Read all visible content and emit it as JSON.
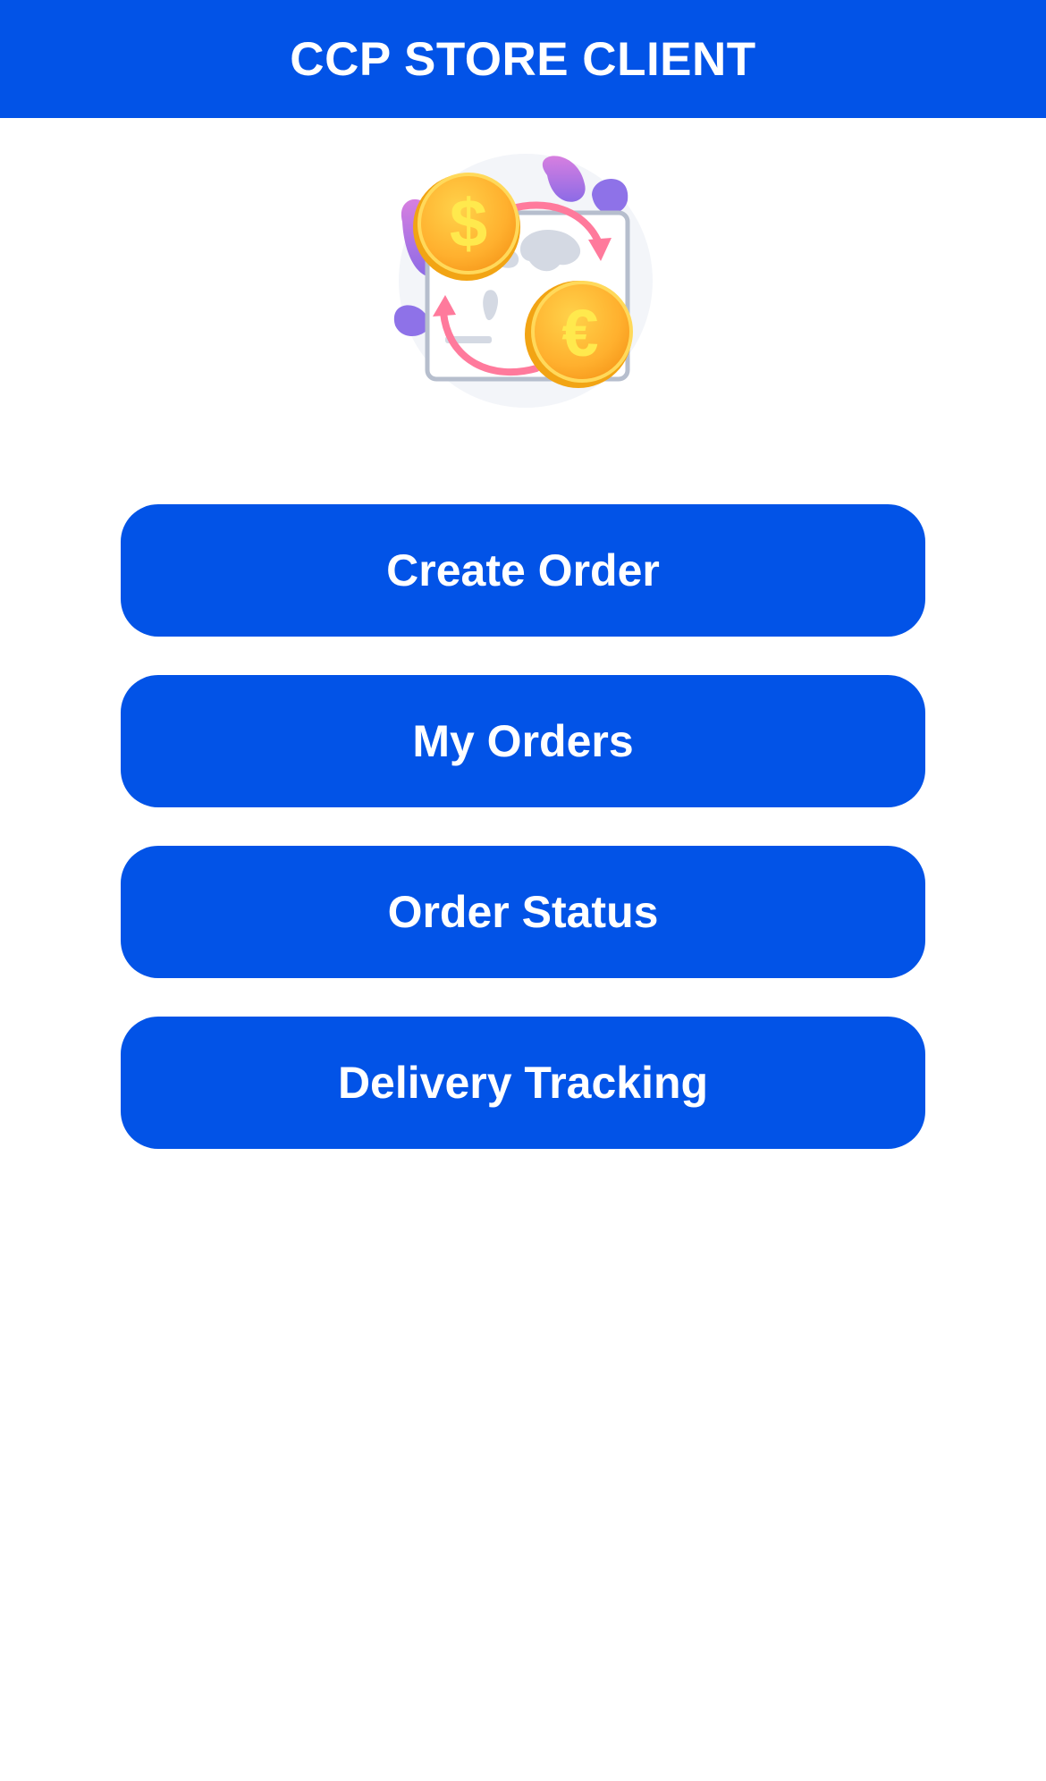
{
  "colors": {
    "primary": "#0253E7",
    "on_primary": "#FFFFFF",
    "background": "#FFFFFF"
  },
  "header": {
    "title": "CCP STORE CLIENT"
  },
  "hero": {
    "icons": [
      "dollar-coin-icon",
      "euro-coin-icon",
      "world-map-icon",
      "exchange-arrows-icon"
    ]
  },
  "menu": {
    "items": [
      {
        "label": "Create Order",
        "icon": "none"
      },
      {
        "label": "My Orders",
        "icon": "none"
      },
      {
        "label": "Order Status",
        "icon": "none"
      },
      {
        "label": "Delivery Tracking",
        "icon": "none"
      }
    ]
  }
}
